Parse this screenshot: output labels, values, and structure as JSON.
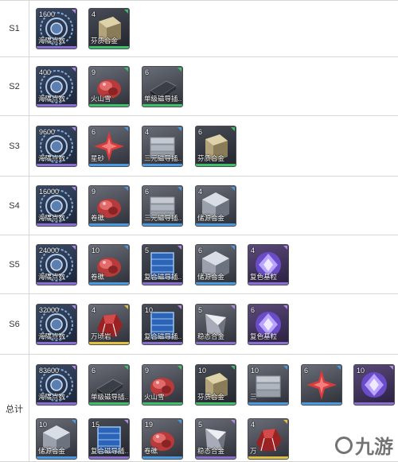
{
  "rows": [
    {
      "label": "S1",
      "items": [
        {
          "count": "1600",
          "name": "海隅点数",
          "icon": "coin-icon",
          "bar": "#8a6fd0",
          "tri": "#b08ae0"
        },
        {
          "count": "4",
          "name": "芬质合金",
          "icon": "alloy-icon",
          "bar": "#3fbf6a",
          "tri": "#3fbf6a"
        }
      ]
    },
    {
      "label": "S2",
      "items": [
        {
          "count": "400",
          "name": "海隅点数",
          "icon": "coin-icon",
          "bar": "#8a6fd0",
          "tri": "#b08ae0"
        },
        {
          "count": "9",
          "name": "火山雪",
          "icon": "ore-icon",
          "bar": "#3fbf6a",
          "tri": "#3fbf6a"
        },
        {
          "count": "6",
          "name": "单级磁导插...",
          "icon": "plate-icon",
          "bar": "#3fbf6a",
          "tri": "#3fbf6a"
        }
      ]
    },
    {
      "label": "S3",
      "items": [
        {
          "count": "9600",
          "name": "海隅点数",
          "icon": "coin-icon",
          "bar": "#8a6fd0",
          "tri": "#b08ae0"
        },
        {
          "count": "6",
          "name": "星砂",
          "icon": "star-icon",
          "bar": "#4a9ae0",
          "tri": "#4a9ae0"
        },
        {
          "count": "4",
          "name": "三元磁导插...",
          "icon": "stack-icon",
          "bar": "#4a9ae0",
          "tri": "#4a9ae0"
        },
        {
          "count": "6",
          "name": "芬质合金",
          "icon": "alloy-icon",
          "bar": "#3fbf6a",
          "tri": "#3fbf6a"
        }
      ]
    },
    {
      "label": "S4",
      "items": [
        {
          "count": "16000",
          "name": "海隅点数",
          "icon": "coin-icon",
          "bar": "#8a6fd0",
          "tri": "#b08ae0"
        },
        {
          "count": "9",
          "name": "卷礁",
          "icon": "ore-icon",
          "bar": "#4a9ae0",
          "tri": "#4a9ae0"
        },
        {
          "count": "6",
          "name": "三元磁导插...",
          "icon": "stack-icon",
          "bar": "#4a9ae0",
          "tri": "#4a9ae0"
        },
        {
          "count": "4",
          "name": "储源合金",
          "icon": "cube-icon",
          "bar": "#4a9ae0",
          "tri": "#4a9ae0"
        }
      ]
    },
    {
      "label": "S5",
      "items": [
        {
          "count": "24000",
          "name": "海隅点数",
          "icon": "coin-icon",
          "bar": "#8a6fd0",
          "tri": "#b08ae0"
        },
        {
          "count": "10",
          "name": "卷礁",
          "icon": "ore-icon",
          "bar": "#4a9ae0",
          "tri": "#4a9ae0"
        },
        {
          "count": "5",
          "name": "复合磁导插...",
          "icon": "blue-stack-icon",
          "bar": "#8a6fd0",
          "tri": "#b08ae0"
        },
        {
          "count": "6",
          "name": "储源合金",
          "icon": "cube-icon",
          "bar": "#4a9ae0",
          "tri": "#4a9ae0"
        },
        {
          "count": "4",
          "name": "复色基粒",
          "icon": "gem-icon",
          "bar": "#8a6fd0",
          "tri": "#b08ae0"
        }
      ]
    },
    {
      "label": "S6",
      "items": [
        {
          "count": "32000",
          "name": "海隅点数",
          "icon": "coin-icon",
          "bar": "#8a6fd0",
          "tri": "#b08ae0"
        },
        {
          "count": "4",
          "name": "万顷岩",
          "icon": "rock-icon",
          "bar": "#e0c040",
          "tri": "#e0c040"
        },
        {
          "count": "10",
          "name": "复合磁导插...",
          "icon": "blue-stack-icon",
          "bar": "#8a6fd0",
          "tri": "#b08ae0"
        },
        {
          "count": "5",
          "name": "稳态合金",
          "icon": "prism-icon",
          "bar": "#8a6fd0",
          "tri": "#b08ae0"
        },
        {
          "count": "6",
          "name": "复色基粒",
          "icon": "gem-icon",
          "bar": "#8a6fd0",
          "tri": "#b08ae0"
        }
      ]
    }
  ],
  "total": {
    "label": "总计",
    "line1": [
      {
        "count": "83600",
        "name": "海隅点数",
        "icon": "coin-icon",
        "bar": "#8a6fd0",
        "tri": "#b08ae0"
      },
      {
        "count": "6",
        "name": "单级磁导插...",
        "icon": "plate-icon",
        "bar": "#3fbf6a",
        "tri": "#3fbf6a"
      },
      {
        "count": "9",
        "name": "火山雪",
        "icon": "ore-icon",
        "bar": "#3fbf6a",
        "tri": "#3fbf6a"
      },
      {
        "count": "10",
        "name": "芬质合金",
        "icon": "alloy-icon",
        "bar": "#3fbf6a",
        "tri": "#3fbf6a"
      },
      {
        "count": "10",
        "name": "三",
        "icon": "stack-icon",
        "bar": "#4a9ae0",
        "tri": "#4a9ae0"
      },
      {
        "count": "6",
        "name": "",
        "icon": "star-icon",
        "bar": "#4a9ae0",
        "tri": "#4a9ae0"
      },
      {
        "count": "10",
        "name": "",
        "icon": "gem-icon",
        "bar": "#8a6fd0",
        "tri": "#b08ae0"
      }
    ],
    "line2": [
      {
        "count": "10",
        "name": "储源合金",
        "icon": "cube-icon",
        "bar": "#4a9ae0",
        "tri": "#4a9ae0"
      },
      {
        "count": "15",
        "name": "复合磁导插...",
        "icon": "blue-stack-icon",
        "bar": "#8a6fd0",
        "tri": "#b08ae0"
      },
      {
        "count": "19",
        "name": "卷礁",
        "icon": "ore-icon",
        "bar": "#4a9ae0",
        "tri": "#4a9ae0"
      },
      {
        "count": "5",
        "name": "稳态合金",
        "icon": "prism-icon",
        "bar": "#8a6fd0",
        "tri": "#b08ae0"
      },
      {
        "count": "4",
        "name": "万",
        "icon": "rock-icon",
        "bar": "#e0c040",
        "tri": "#e0c040"
      }
    ]
  },
  "watermark": {
    "text": "九游"
  }
}
